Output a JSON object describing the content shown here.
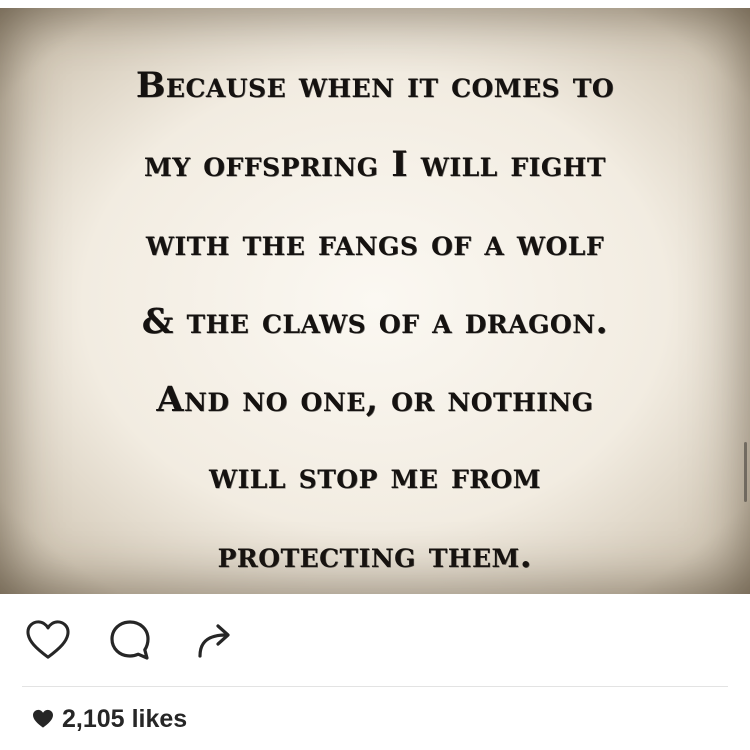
{
  "post": {
    "quote_lines": [
      "Because when it comes to",
      "my offspring I will fight",
      "with the fangs of a wolf",
      "& the claws of a dragon.",
      "And no one, or nothing",
      "will stop me from",
      "protecting them."
    ],
    "likes_count": "2,105",
    "likes_label": "likes"
  },
  "icons": {
    "like": "heart-outline-icon",
    "comment": "comment-bubble-icon",
    "share": "share-arrow-icon",
    "likes_marker": "heart-filled-icon"
  },
  "colors": {
    "text": "#151210",
    "likes_text": "#262626",
    "icon": "#262626"
  }
}
